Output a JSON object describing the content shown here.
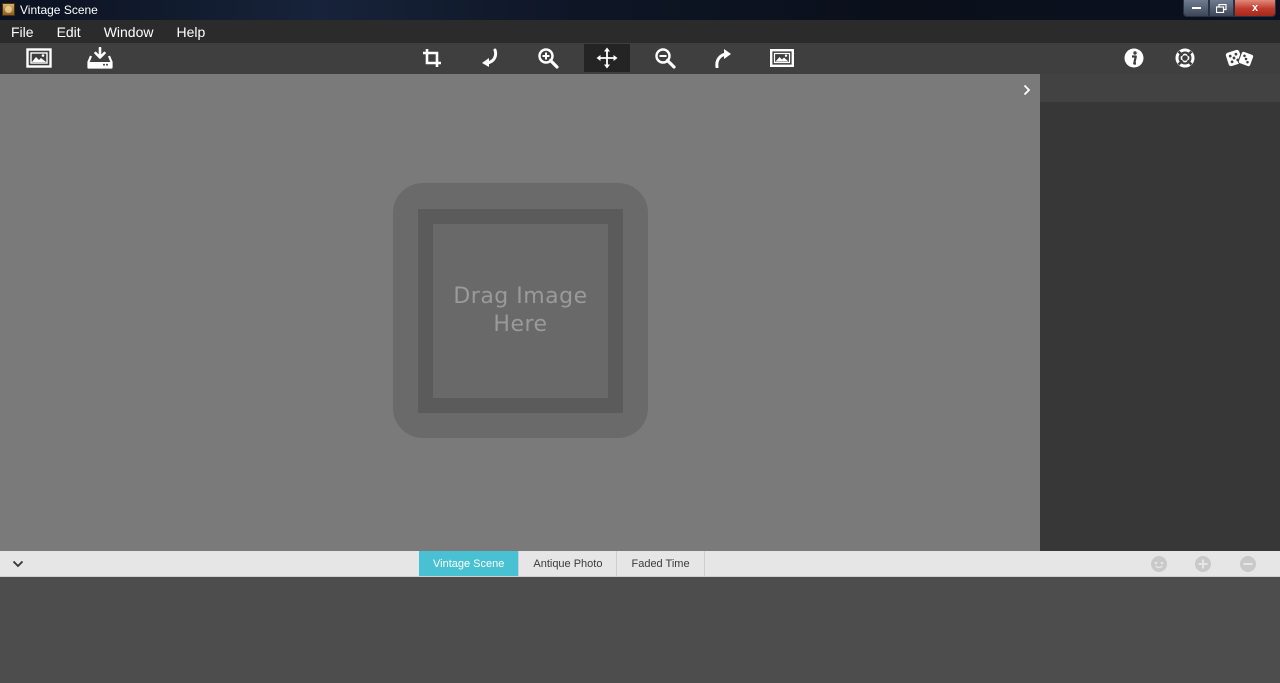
{
  "window": {
    "title": "Vintage Scene",
    "minimize": "",
    "maximize": "",
    "close": "x"
  },
  "menu": [
    "File",
    "Edit",
    "Window",
    "Help"
  ],
  "toolbar": {
    "left": [
      "open-image-icon",
      "save-icon"
    ],
    "center": [
      "crop-icon",
      "rotate-left-icon",
      "zoom-in-icon",
      "move-icon",
      "zoom-out-icon",
      "rotate-right-icon",
      "fit-image-icon"
    ],
    "right": [
      "info-icon",
      "help-icon",
      "random-icon"
    ],
    "active": "move-icon"
  },
  "canvas": {
    "drop_text_line1": "Drag Image",
    "drop_text_line2": "Here"
  },
  "tabs": [
    {
      "label": "Vintage Scene",
      "active": true
    },
    {
      "label": "Antique Photo",
      "active": false
    },
    {
      "label": "Faded Time",
      "active": false
    }
  ],
  "preset_actions": [
    "preset-icon",
    "add-icon",
    "remove-icon"
  ],
  "colors": {
    "accent": "#48c1d3",
    "canvas": "#7a7a7a",
    "panel": "#373737",
    "toolbar": "#3f3f3f"
  }
}
